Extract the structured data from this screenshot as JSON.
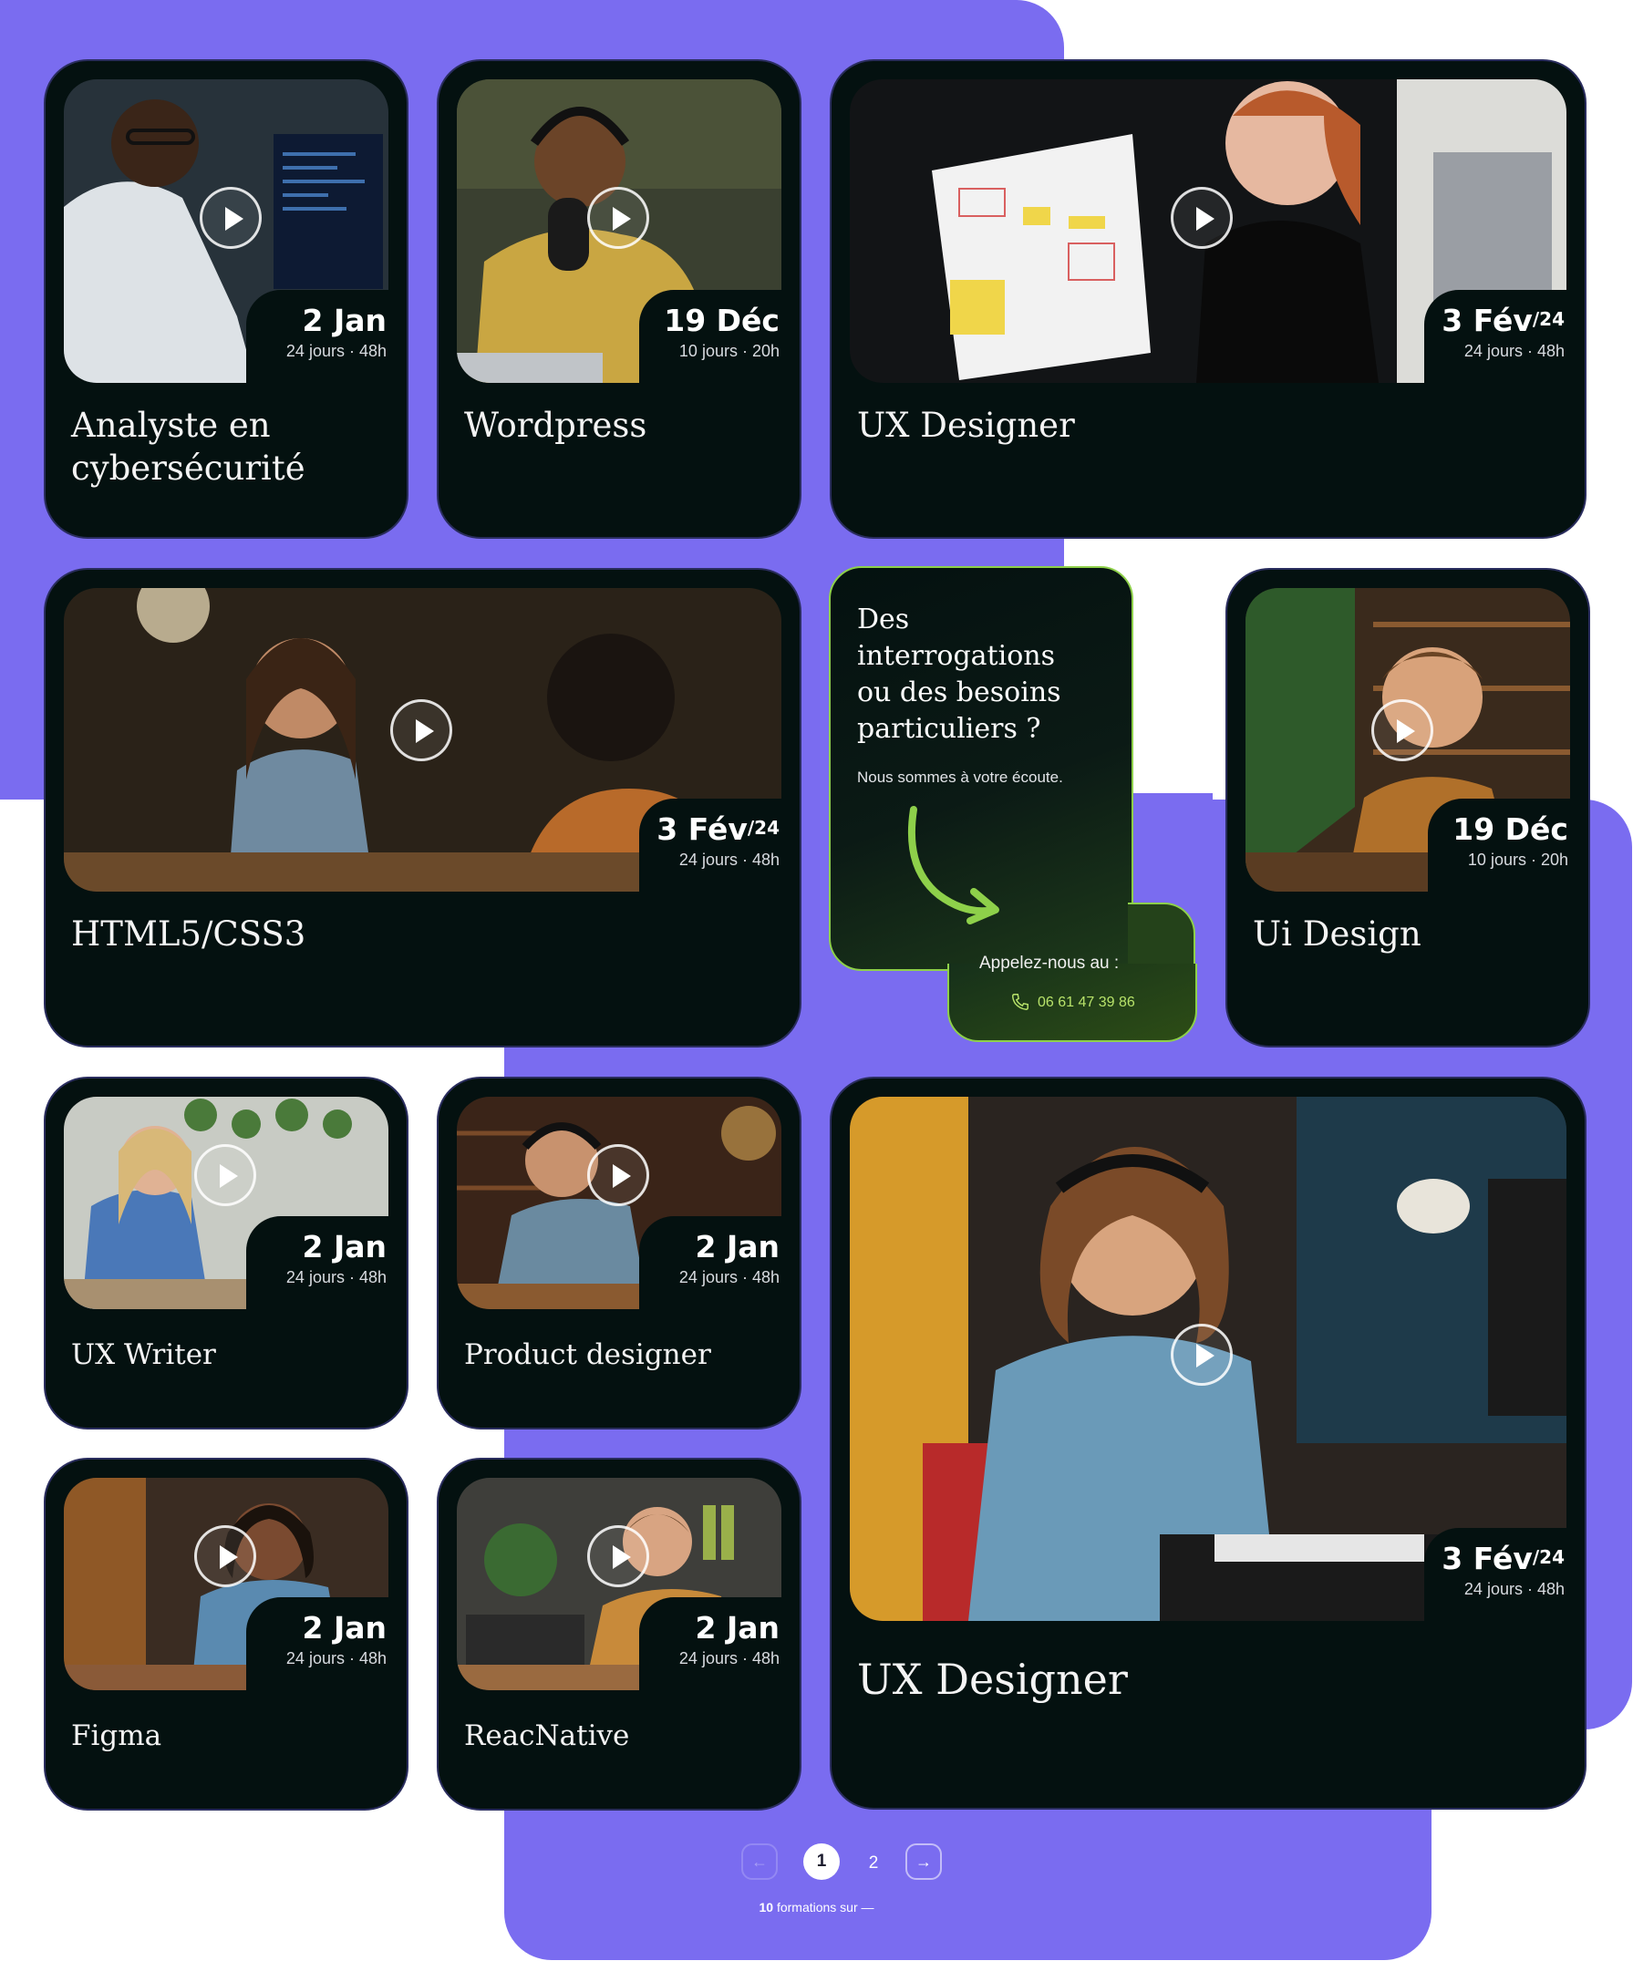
{
  "cards": [
    {
      "date": "2 Jan",
      "sup": "",
      "dur": "24 jours · 48h",
      "title": "Analyste en cybersécurité"
    },
    {
      "date": "19 Déc",
      "sup": "",
      "dur": "10 jours · 20h",
      "title": "Wordpress"
    },
    {
      "date": "3 Fév",
      "sup": "/24",
      "dur": "24 jours · 48h",
      "title": "UX Designer"
    },
    {
      "date": "3 Fév",
      "sup": "/24",
      "dur": "24 jours · 48h",
      "title": "HTML5/CSS3"
    },
    {
      "date": "19 Déc",
      "sup": "",
      "dur": "10 jours · 20h",
      "title": "Ui Design"
    },
    {
      "date": "2 Jan",
      "sup": "",
      "dur": "24 jours · 48h",
      "title": "UX Writer"
    },
    {
      "date": "2 Jan",
      "sup": "",
      "dur": "24 jours · 48h",
      "title": "Product designer"
    },
    {
      "date": "3 Fév",
      "sup": "/24",
      "dur": "24 jours · 48h",
      "title": "UX Designer"
    },
    {
      "date": "2 Jan",
      "sup": "",
      "dur": "24 jours · 48h",
      "title": "Figma"
    },
    {
      "date": "2 Jan",
      "sup": "",
      "dur": "24 jours · 48h",
      "title": "ReacNative"
    }
  ],
  "cta": {
    "question": "Des interrogations ou des besoins particuliers ?",
    "subtitle": "Nous sommes à votre écoute.",
    "call_label": "Appelez-nous au :",
    "phone": "06 61 47 39 86",
    "accent_color": "#8ed04a"
  },
  "pagination": {
    "prev_icon": "arrow-left-icon",
    "pages": [
      "1",
      "2"
    ],
    "current": "1",
    "next_icon": "arrow-right-icon",
    "count_number": "10",
    "count_text": "formations sur —"
  },
  "colors": {
    "background_accent": "#7a6cf0",
    "card": "#041110"
  }
}
